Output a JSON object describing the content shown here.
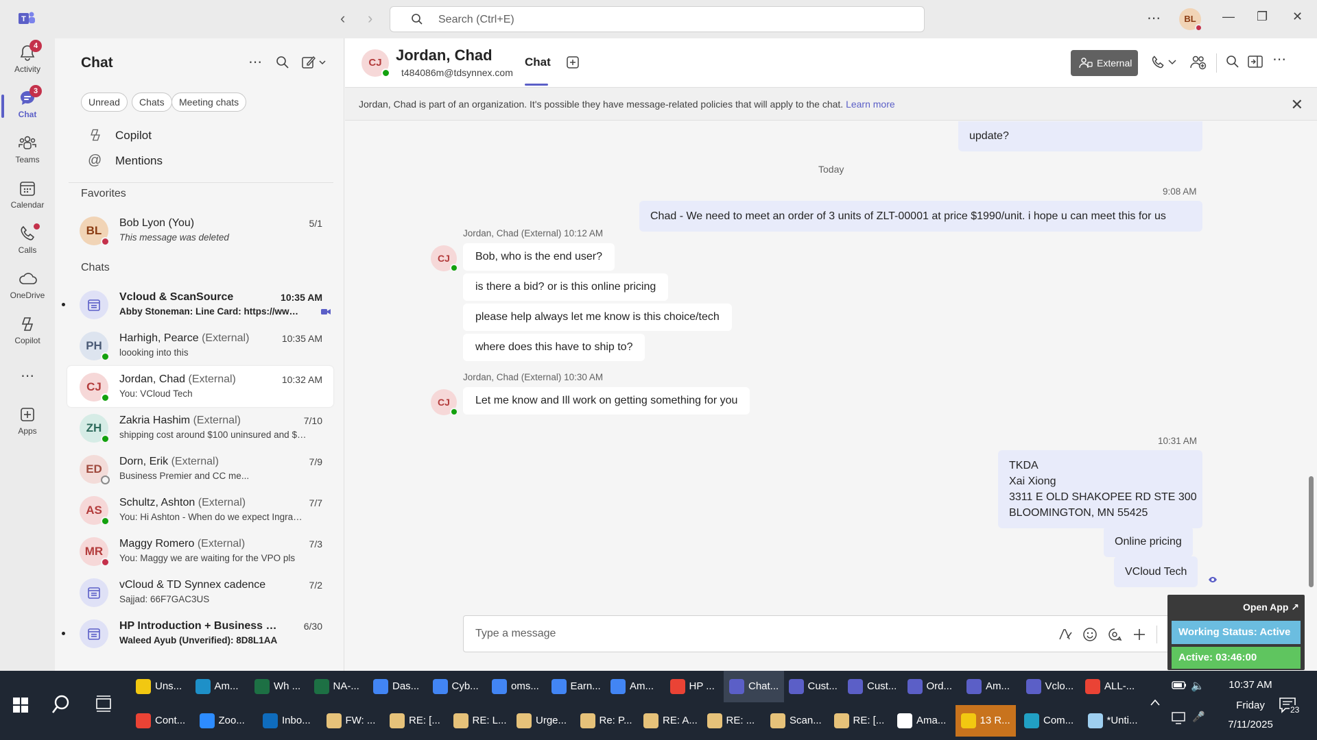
{
  "titlebar": {
    "search_placeholder": "Search (Ctrl+E)",
    "avatar_initials": "BL"
  },
  "rail": [
    {
      "label": "Activity",
      "badge": "4",
      "icon": "bell-icon"
    },
    {
      "label": "Chat",
      "badge": "3",
      "icon": "chat-icon",
      "active": true
    },
    {
      "label": "Teams",
      "icon": "teams-icon"
    },
    {
      "label": "Calendar",
      "icon": "calendar-icon"
    },
    {
      "label": "Calls",
      "icon": "phone-icon",
      "dot": true
    },
    {
      "label": "OneDrive",
      "icon": "cloud-icon"
    },
    {
      "label": "Copilot",
      "icon": "copilot-icon"
    },
    {
      "label": "Apps",
      "icon": "apps-icon"
    }
  ],
  "chatpane": {
    "title": "Chat",
    "filters": [
      "Unread",
      "Chats",
      "Meeting chats"
    ],
    "copilot": "Copilot",
    "mentions": "Mentions",
    "favorites_label": "Favorites",
    "chats_label": "Chats",
    "favorites": [
      {
        "initials": "BL",
        "name": "Bob Lyon (You)",
        "time": "5/1",
        "preview": "This message was deleted"
      }
    ],
    "chats": [
      {
        "initials": "",
        "name": "Vcloud & ScanSource",
        "ext": "",
        "time": "10:35 AM",
        "preview": "Abby Stoneman: Line Card: https://www....",
        "bold": true
      },
      {
        "initials": "PH",
        "name": "Harhigh, Pearce",
        "ext": "(External)",
        "time": "10:35 AM",
        "preview": "loooking into this"
      },
      {
        "initials": "CJ",
        "name": "Jordan, Chad",
        "ext": "(External)",
        "time": "10:32 AM",
        "preview": "You: VCloud Tech",
        "selected": true
      },
      {
        "initials": "ZH",
        "name": "Zakria Hashim",
        "ext": "(External)",
        "time": "7/10",
        "preview": "shipping cost around $100 uninsured and $14..."
      },
      {
        "initials": "ED",
        "name": "Dorn, Erik",
        "ext": "(External)",
        "time": "7/9",
        "preview": "Business Premier and CC me..."
      },
      {
        "initials": "AS",
        "name": "Schultz, Ashton",
        "ext": "(External)",
        "time": "7/7",
        "preview": "You: Hi Ashton -  When do we expect Ingram ..."
      },
      {
        "initials": "MR",
        "name": "Maggy Romero",
        "ext": "(External)",
        "time": "7/3",
        "preview": "You: Maggy we are waiting for the VPO pls"
      },
      {
        "initials": "",
        "name": "vCloud & TD Synnex cadence",
        "ext": "",
        "time": "7/2",
        "preview": "Sajjad: 66F7GAC3US"
      },
      {
        "initials": "",
        "name": "HP Introduction + Business Dis...",
        "ext": "",
        "time": "6/30",
        "preview": "Waleed Ayub (Unverified): 8D8L1AA",
        "bold": true
      }
    ]
  },
  "conversation": {
    "initials": "CJ",
    "name": "Jordan, Chad",
    "email": "t484086m@tdsynnex.com",
    "tab": "Chat",
    "external_label": "External",
    "banner_text": "Jordan, Chad is part of an organization. It's possible they have message-related policies that will apply to the chat.",
    "banner_link": "Learn more",
    "earlier_fragment": "update?",
    "today_label": "Today",
    "my_msg_1_time": "9:08 AM",
    "my_msg_1": "Chad -  We need to meet an order of 3 units of ZLT-00001 at price $1990/unit. i hope u can meet this for us",
    "their_group_1_meta": "Jordan, Chad (External)   10:12 AM",
    "their_group_1": [
      "Bob, who is the end user?",
      "is there a bid? or is this online pricing",
      "please help always let me know is this choice/tech",
      "where does this have to ship to?"
    ],
    "their_group_2_meta": "Jordan, Chad (External)   10:30 AM",
    "their_group_2": [
      "Let me know and Ill work on getting something for you"
    ],
    "my_group_2_time": "10:31 AM",
    "address_lines": [
      "TKDA",
      "Xai Xiong",
      "3311 E OLD SHAKOPEE RD STE 300",
      "BLOOMINGTON, MN 55425"
    ],
    "my_msg_3": "Online pricing",
    "my_msg_4": "VCloud Tech",
    "compose_placeholder": "Type a message"
  },
  "widget": {
    "open_app": "Open App ↗",
    "status": "Working Status: Active",
    "active": "Active: 03:46:00"
  },
  "taskbar": {
    "row1": [
      {
        "label": "Uns...",
        "icon": "sticky-notes-icon",
        "color": "#f2c811"
      },
      {
        "label": "Am...",
        "icon": "edge-icon",
        "color": "#1e90c8"
      },
      {
        "label": "Wh ...",
        "icon": "excel-icon",
        "color": "#1d7044"
      },
      {
        "label": "NA-...",
        "icon": "excel-icon",
        "color": "#1d7044"
      },
      {
        "label": "Das...",
        "icon": "chrome-icon",
        "color": "#4285f4"
      },
      {
        "label": "Cyb...",
        "icon": "chrome-icon",
        "color": "#4285f4"
      },
      {
        "label": "oms...",
        "icon": "chrome-icon",
        "color": "#4285f4"
      },
      {
        "label": "Earn...",
        "icon": "chrome-icon",
        "color": "#4285f4"
      },
      {
        "label": "Am...",
        "icon": "chrome-icon",
        "color": "#4285f4"
      },
      {
        "label": "HP ...",
        "icon": "chrome-icon",
        "color": "#ea4335"
      },
      {
        "label": "Chat...",
        "icon": "teams-icon",
        "color": "#5b5fc7",
        "active": true
      },
      {
        "label": "Cust...",
        "icon": "teams-icon",
        "color": "#5b5fc7"
      },
      {
        "label": "Cust...",
        "icon": "teams-icon",
        "color": "#5b5fc7"
      },
      {
        "label": "Ord...",
        "icon": "teams-icon",
        "color": "#5b5fc7"
      },
      {
        "label": "Am...",
        "icon": "teams-icon",
        "color": "#5b5fc7"
      },
      {
        "label": "Vclo...",
        "icon": "teams-icon",
        "color": "#5b5fc7"
      },
      {
        "label": "ALL-...",
        "icon": "chrome-icon",
        "color": "#ea4335"
      }
    ],
    "row2": [
      {
        "label": "Cont...",
        "icon": "chrome-icon",
        "color": "#ea4335"
      },
      {
        "label": "Zoo...",
        "icon": "zoom-icon",
        "color": "#2d8cff"
      },
      {
        "label": "Inbo...",
        "icon": "outlook-icon",
        "color": "#0f6cbd"
      },
      {
        "label": "FW: ...",
        "icon": "mail-icon",
        "color": "#e6c27a"
      },
      {
        "label": "RE: [...",
        "icon": "mail-icon",
        "color": "#e6c27a"
      },
      {
        "label": "RE: L...",
        "icon": "mail-icon",
        "color": "#e6c27a"
      },
      {
        "label": "Urge...",
        "icon": "mail-icon",
        "color": "#e6c27a"
      },
      {
        "label": "Re: P...",
        "icon": "mail-icon",
        "color": "#e6c27a"
      },
      {
        "label": "RE: A...",
        "icon": "mail-icon",
        "color": "#e6c27a"
      },
      {
        "label": "RE: ...",
        "icon": "mail-icon",
        "color": "#e6c27a"
      },
      {
        "label": "Scan...",
        "icon": "mail-icon",
        "color": "#e6c27a"
      },
      {
        "label": "RE: [...",
        "icon": "mail-icon",
        "color": "#e6c27a"
      },
      {
        "label": "Ama...",
        "icon": "window-icon",
        "color": "#ffffff"
      },
      {
        "label": "13 R...",
        "icon": "bell-icon",
        "color": "#f2c811",
        "alert": true
      },
      {
        "label": "Com...",
        "icon": "app-icon",
        "color": "#21a0c4"
      },
      {
        "label": "*Unti...",
        "icon": "notepad-icon",
        "color": "#9ecff0"
      }
    ],
    "time": "10:37 AM",
    "day": "Friday",
    "date": "7/11/2025",
    "notif_count": "23"
  }
}
